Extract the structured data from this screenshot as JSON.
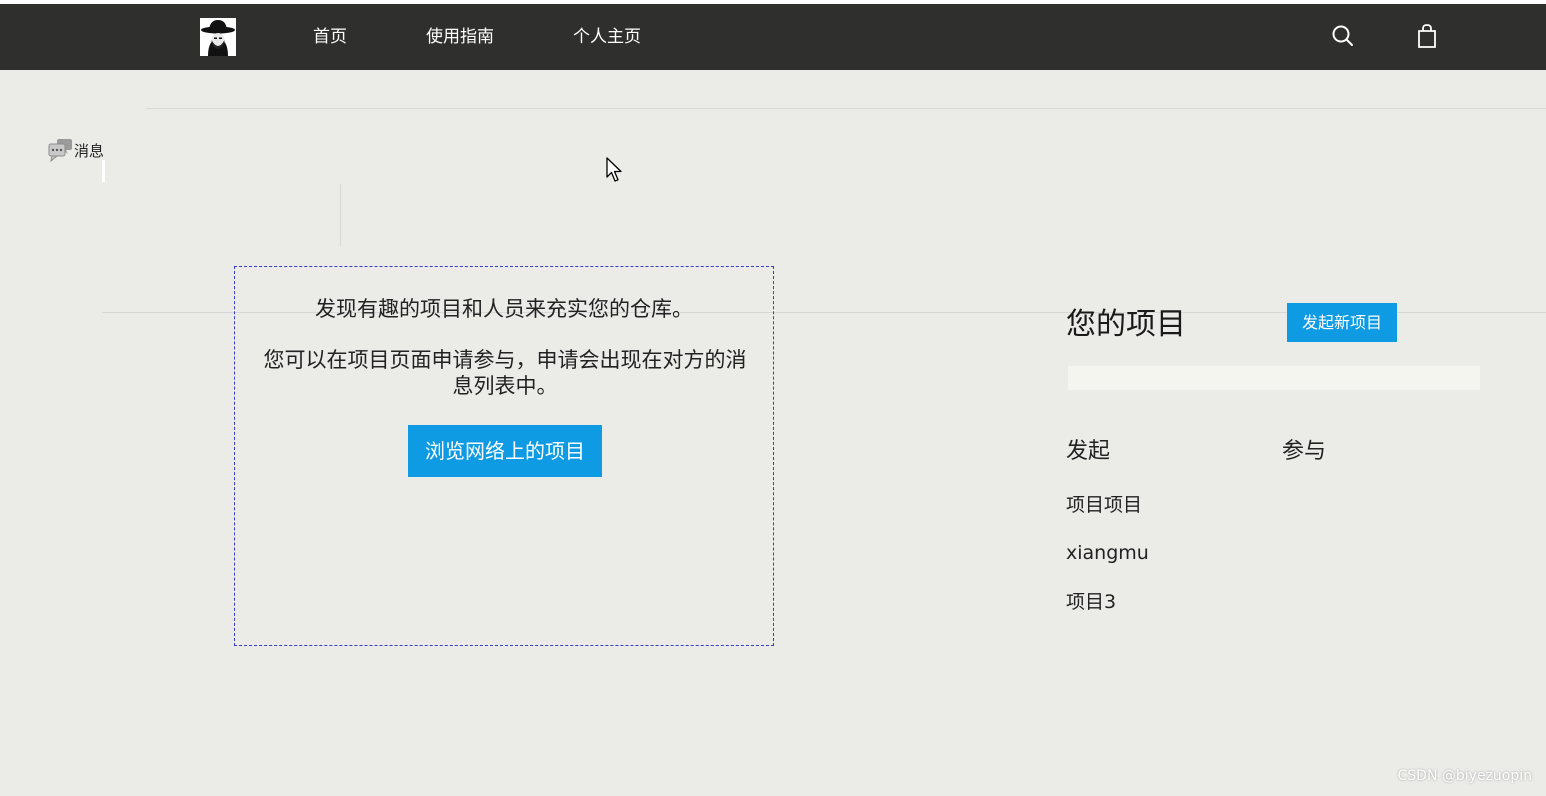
{
  "nav": {
    "links": [
      "首页",
      "使用指南",
      "个人主页"
    ],
    "icons": [
      "search-icon",
      "shopping-bag-icon"
    ],
    "background": "#2f302e"
  },
  "sidebar": {
    "messages_label": "消息"
  },
  "info": {
    "line1": "发现有趣的项目和人员来充实您的仓库。",
    "line2": "您可以在项目页面申请参与，申请会出现在对方的消息列表中。",
    "browse_button": "浏览网络上的项目"
  },
  "projects": {
    "title": "您的项目",
    "new_button": "发起新项目",
    "search_value": "",
    "tabs": [
      "发起",
      "参与"
    ],
    "items": [
      "项目项目",
      "xiangmu",
      "项目3"
    ]
  },
  "watermark": "CSDN @biyezuopin",
  "colors": {
    "accent": "#0f9be3",
    "page_background": "#ebebe8",
    "box_border": "#3a3acb"
  }
}
